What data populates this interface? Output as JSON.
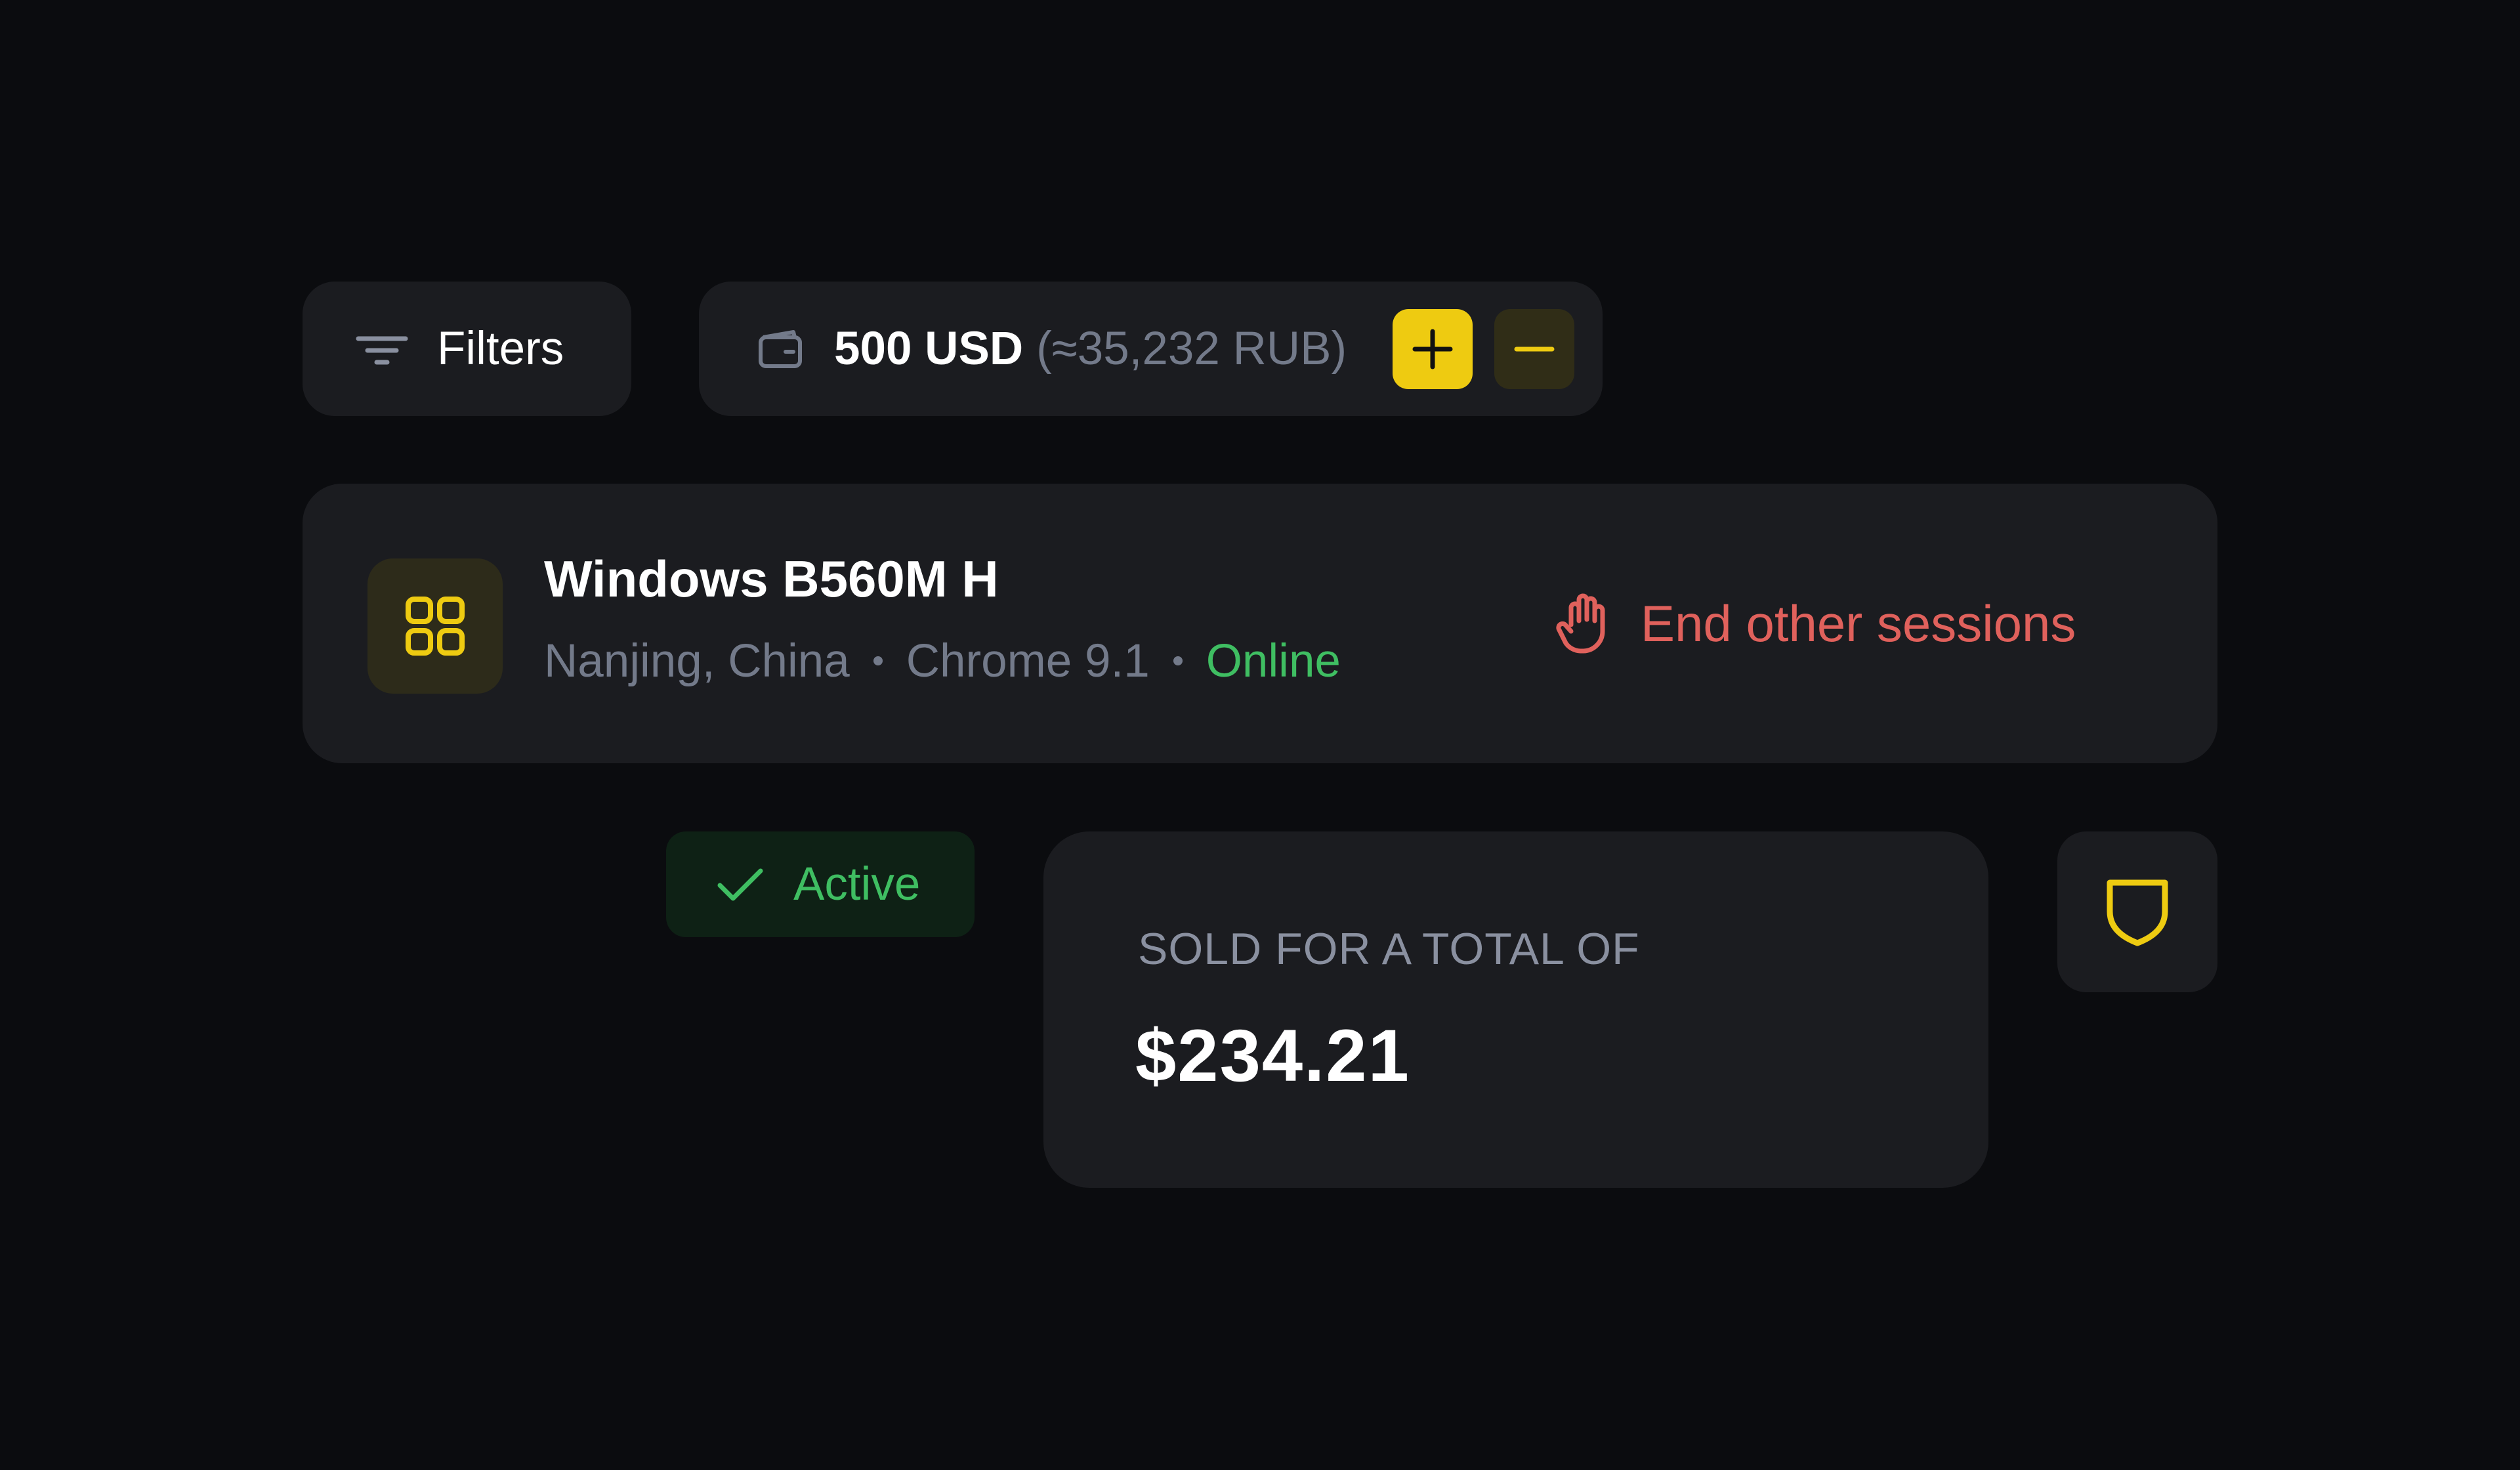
{
  "toolbar": {
    "filters_label": "Filters",
    "filters_icon": "filter-lines-icon"
  },
  "balance": {
    "icon": "wallet-icon",
    "amount": "500 USD",
    "converted": "(≈35,232 RUB)",
    "add_icon": "plus-icon",
    "remove_icon": "minus-icon",
    "accent_color": "#eecb11"
  },
  "session": {
    "device_icon": "grid-icon",
    "device_name": "Windows B560M H",
    "location": "Nanjing, China",
    "browser": "Chrome 9.1",
    "status": "Online",
    "status_color": "#3fbe62",
    "end_sessions_icon": "hand-stop-icon",
    "end_sessions_label": "End other sessions",
    "danger_color": "#e0615c"
  },
  "status_badge": {
    "icon": "check-icon",
    "label": "Active"
  },
  "sales": {
    "caption": "SOLD FOR A TOTAL OF",
    "total": "$234.21"
  },
  "shield_button": {
    "icon": "shield-icon"
  }
}
